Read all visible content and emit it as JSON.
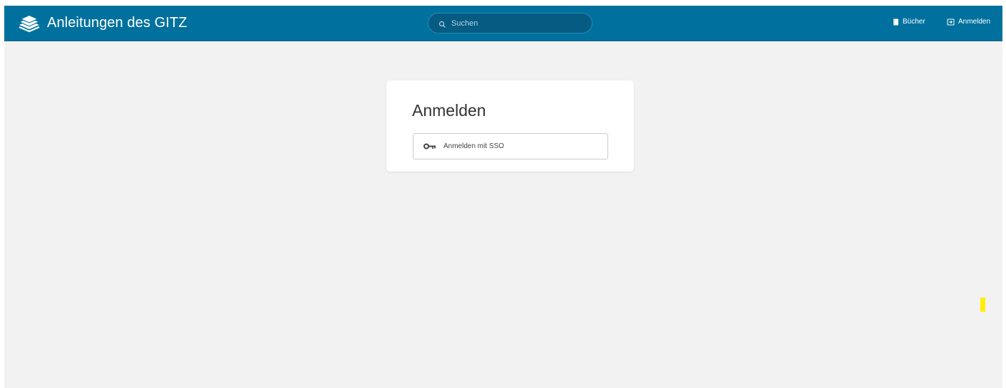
{
  "header": {
    "title": "Anleitungen des GITZ",
    "logo_icon": "books-stack-icon",
    "search": {
      "placeholder": "Suchen",
      "value": "",
      "icon": "search-icon"
    },
    "nav": [
      {
        "label": "Bücher",
        "icon": "book-icon"
      },
      {
        "label": "Anmelden",
        "icon": "login-icon"
      }
    ]
  },
  "login_card": {
    "title": "Anmelden",
    "sso_button": {
      "label": "Anmelden mit SSO",
      "icon": "key-icon"
    }
  },
  "colors": {
    "header_bg": "#00719e",
    "search_bg": "#055b82",
    "page_bg": "#f2f2f2",
    "card_bg": "#ffffff",
    "marker": "#ffee00"
  }
}
